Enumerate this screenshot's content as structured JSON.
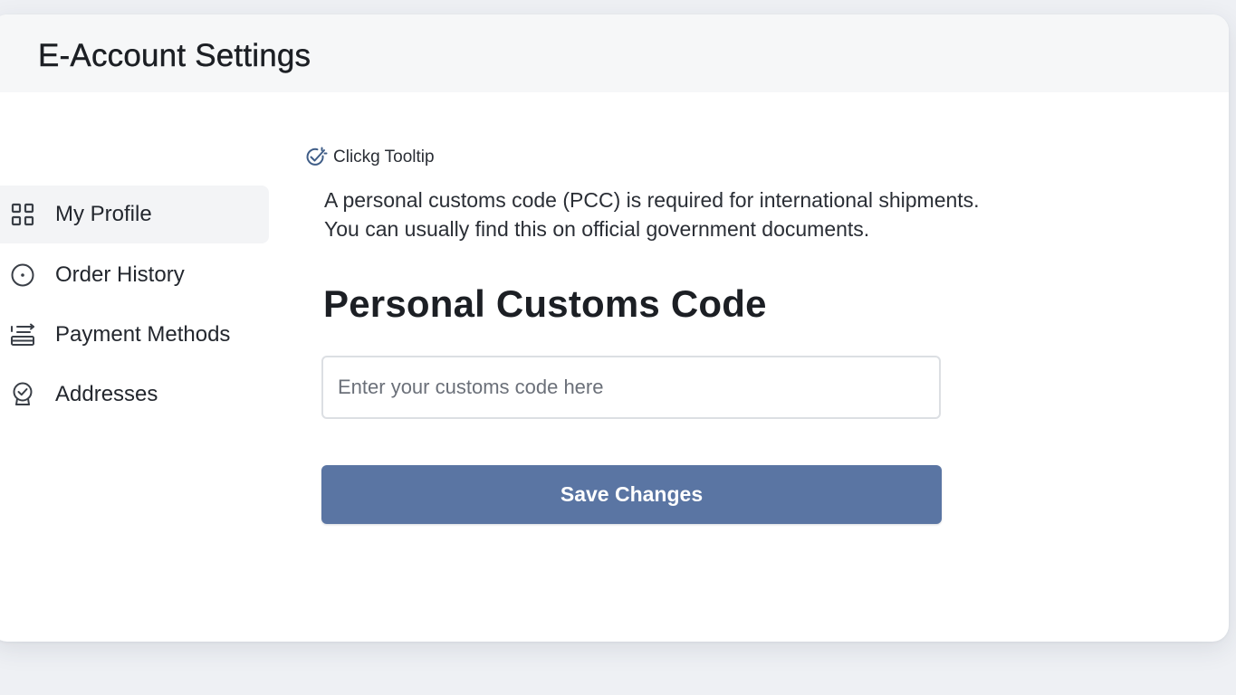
{
  "app": {
    "title": "E-Account Settings"
  },
  "sidebar": {
    "items": [
      {
        "label": "My Profile",
        "icon": "grid-icon",
        "active": true
      },
      {
        "label": "Order History",
        "icon": "circle-dot-icon",
        "active": false
      },
      {
        "label": "Payment Methods",
        "icon": "transfer-list-icon",
        "active": false
      },
      {
        "label": "Addresses",
        "icon": "location-check-icon",
        "active": false
      }
    ]
  },
  "main": {
    "tooltip": {
      "label": "Clickg Tooltip",
      "icon": "check-sparkle-icon"
    },
    "help_text": {
      "line1": "A personal customs code (PCC) is required for international shipments.",
      "line2": "You can usually find this on official government documents."
    },
    "section_title": "Personal Customs Code",
    "customs_input": {
      "value": "",
      "placeholder": "Enter your customs code here"
    },
    "save_label": "Save Changes"
  },
  "colors": {
    "accent": "#5a75a3",
    "background": "#eef0f4",
    "header": "#f6f7f8",
    "active_nav": "#f3f4f6"
  }
}
